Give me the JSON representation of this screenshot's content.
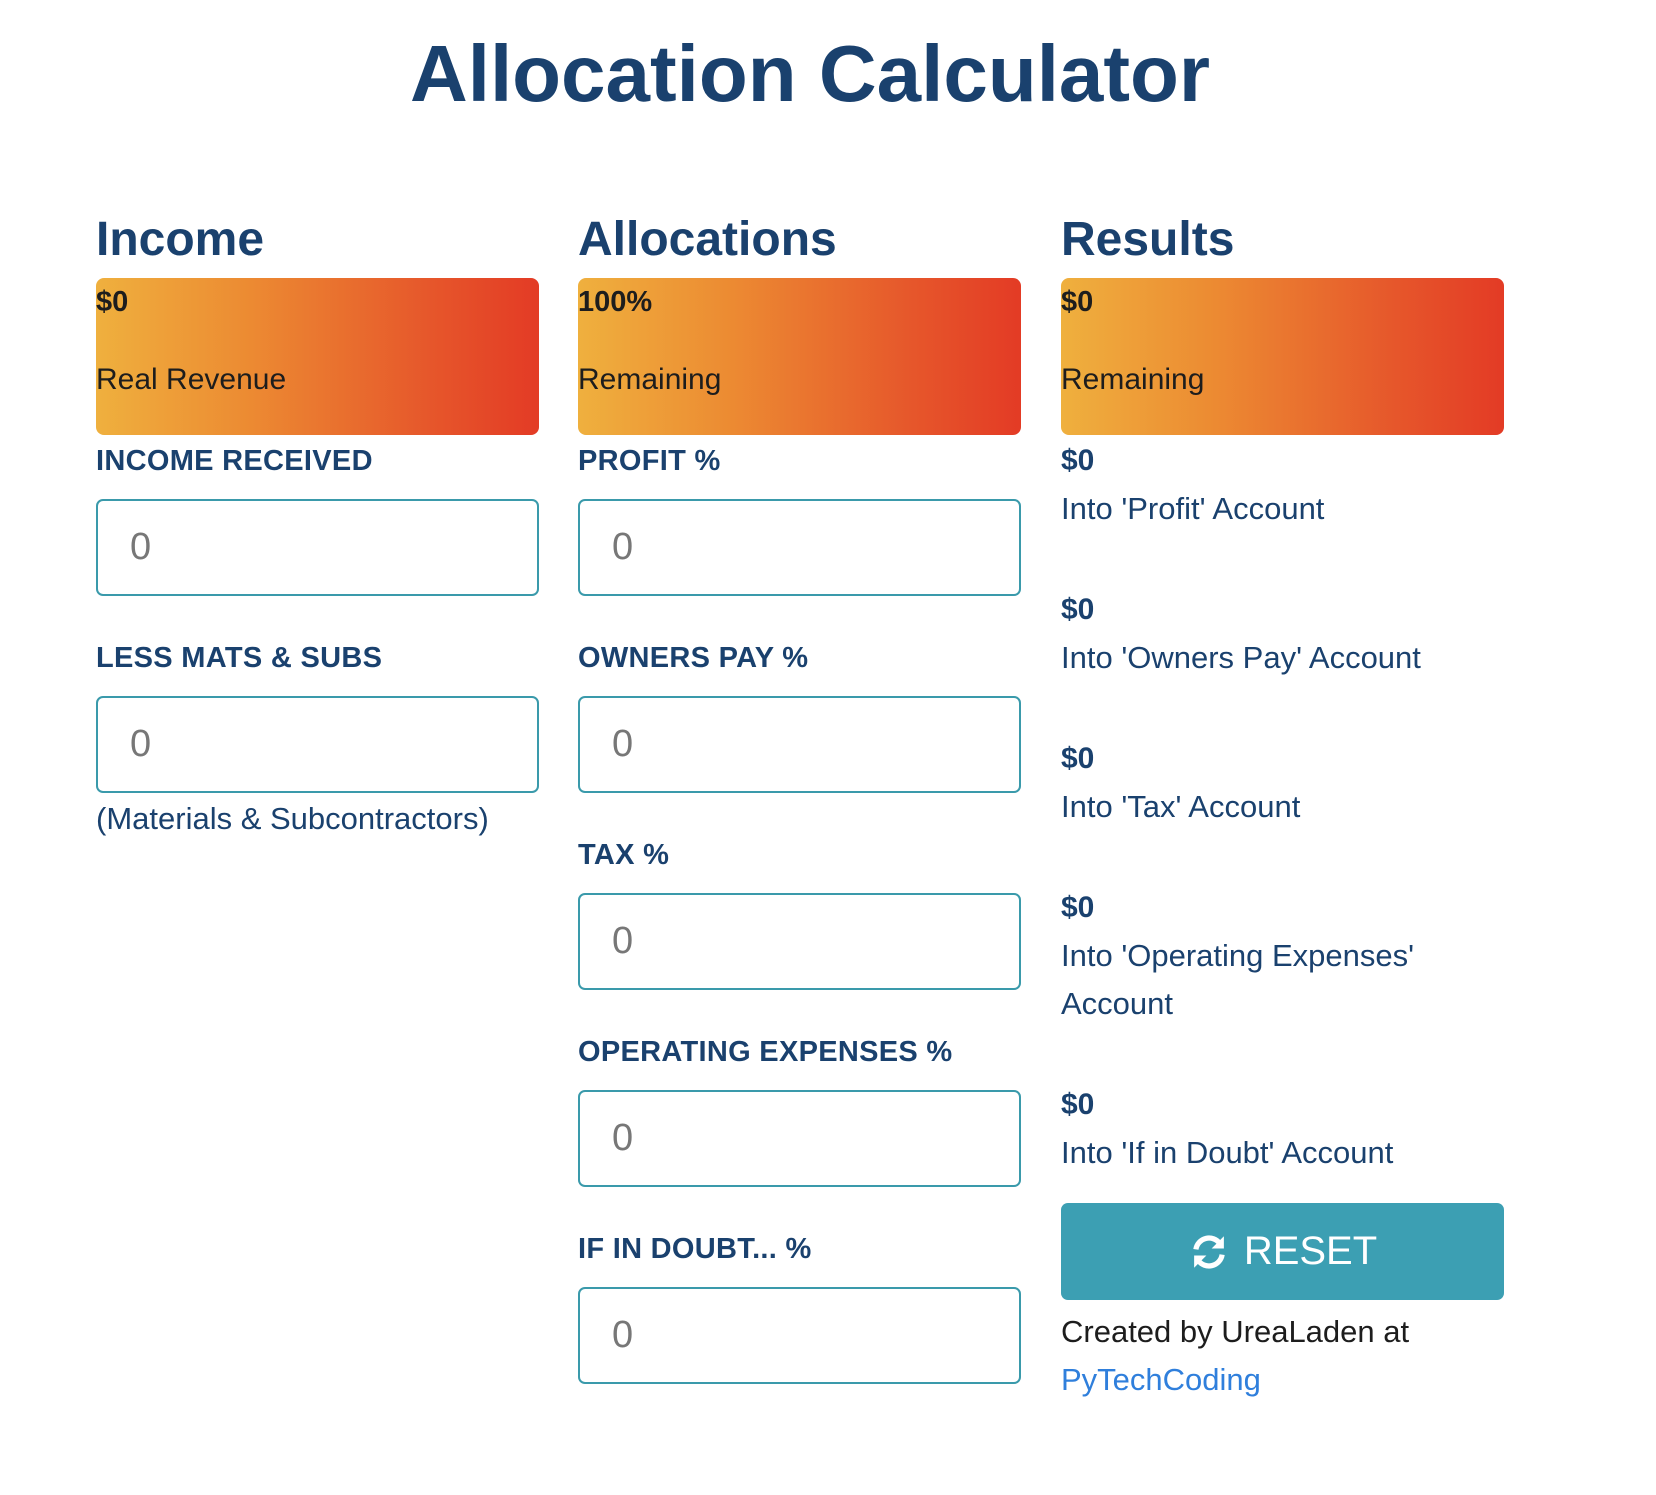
{
  "title": "Allocation Calculator",
  "income": {
    "heading": "Income",
    "banner": {
      "value": "$0",
      "label": "Real Revenue"
    },
    "fields": [
      {
        "label": "INCOME RECEIVED",
        "placeholder": "0",
        "value": ""
      },
      {
        "label": "LESS MATS & SUBS",
        "placeholder": "0",
        "value": ""
      }
    ],
    "note": "(Materials & Subcontractors)"
  },
  "allocations": {
    "heading": "Allocations",
    "banner": {
      "value": "100%",
      "label": "Remaining"
    },
    "fields": [
      {
        "label": "PROFIT %",
        "placeholder": "0",
        "value": ""
      },
      {
        "label": "OWNERS PAY %",
        "placeholder": "0",
        "value": ""
      },
      {
        "label": "TAX %",
        "placeholder": "0",
        "value": ""
      },
      {
        "label": "OPERATING EXPENSES %",
        "placeholder": "0",
        "value": ""
      },
      {
        "label": "IF IN DOUBT... %",
        "placeholder": "0",
        "value": ""
      }
    ]
  },
  "results": {
    "heading": "Results",
    "banner": {
      "value": "$0",
      "label": "Remaining"
    },
    "items": [
      {
        "amount": "$0",
        "label": "Into 'Profit' Account"
      },
      {
        "amount": "$0",
        "label": "Into 'Owners Pay' Account"
      },
      {
        "amount": "$0",
        "label": "Into 'Tax' Account"
      },
      {
        "amount": "$0",
        "label": "Into 'Operating Expenses' Account"
      },
      {
        "amount": "$0",
        "label": "Into 'If in Doubt' Account"
      }
    ],
    "reset_label": "RESET",
    "reset_icon": "refresh-icon",
    "credit_text": "Created by UreaLaden at",
    "credit_link": "PyTechCoding"
  },
  "colors": {
    "heading": "#1a416e",
    "accent": "#3c9fb3",
    "link": "#2f7fdc",
    "banner_start": "#efb03e",
    "banner_end": "#e33b25"
  }
}
